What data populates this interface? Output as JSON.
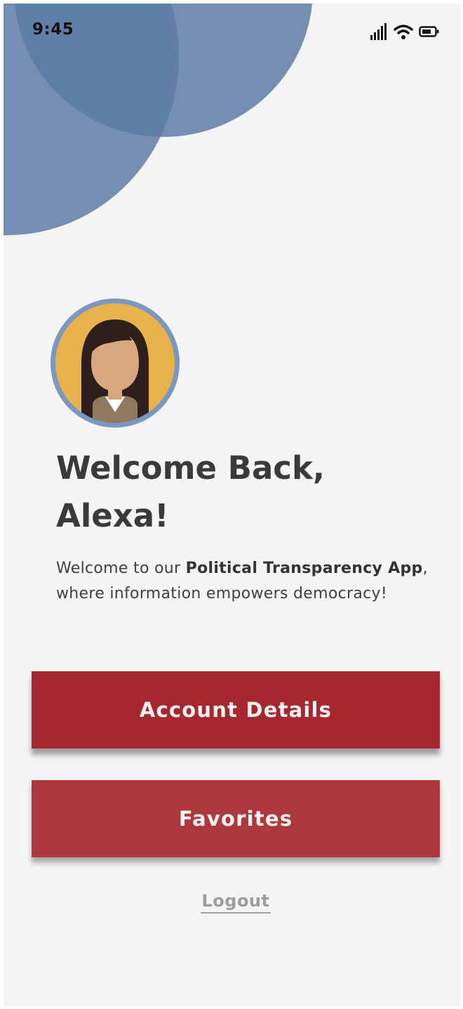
{
  "status_bar": {
    "time": "9:45",
    "icons": [
      "cellular-signal-icon",
      "wifi-icon",
      "battery-icon"
    ]
  },
  "avatar": {
    "icon": "user-avatar-woman"
  },
  "welcome": {
    "title_line1": "Welcome Back,",
    "title_line2": "Alexa!",
    "intro_prefix": "Welcome to our ",
    "intro_bold": "Political Transparency App",
    "intro_suffix": ", where information empowers democracy!"
  },
  "buttons": {
    "account_details": "Account Details",
    "favorites": "Favorites"
  },
  "logout_label": "Logout",
  "colors": {
    "accent_blue": "#6d8bb4",
    "primary_red": "#a6282f",
    "secondary_red": "#ad393d",
    "background": "#f4f4f5"
  }
}
